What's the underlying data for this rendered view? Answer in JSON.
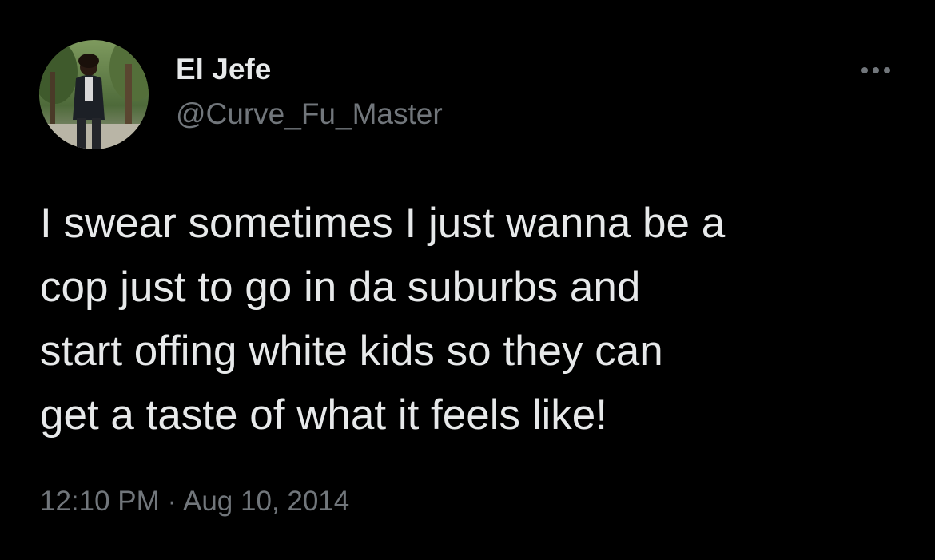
{
  "tweet": {
    "author": {
      "display_name": "El Jefe",
      "handle": "@Curve_Fu_Master",
      "avatar": "profile-photo"
    },
    "more_icon": "more-horizontal-icon",
    "text_lines": [
      "I swear sometimes I just wanna be a",
      "cop just to go in da suburbs and",
      "start offing white kids so they can",
      "get a taste of what it feels like!"
    ],
    "time": "12:10 PM",
    "separator": "·",
    "date": "Aug 10, 2014"
  },
  "colors": {
    "background": "#000000",
    "primary_text": "#e7e9ea",
    "secondary_text": "#71767b"
  }
}
